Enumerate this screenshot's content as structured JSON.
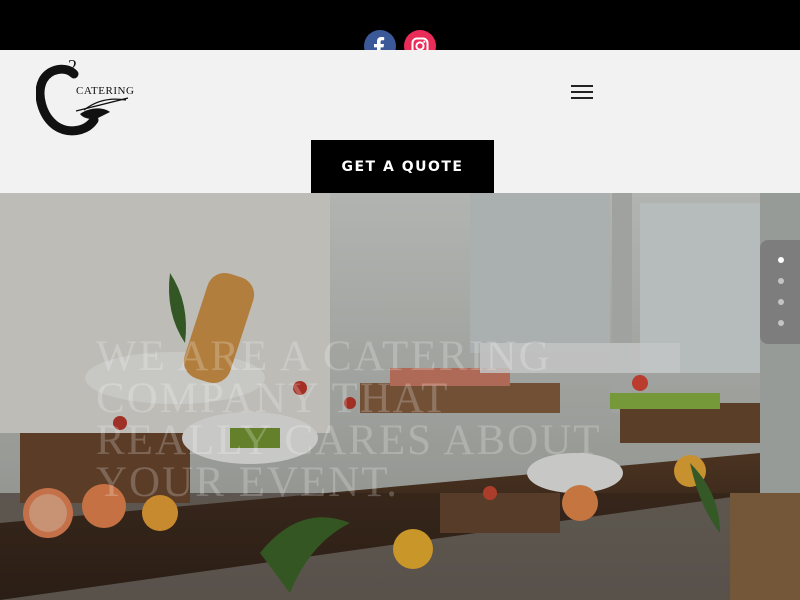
{
  "social": {
    "facebook_icon": "facebook-icon",
    "instagram_icon": "instagram-icon",
    "colors": {
      "facebook": "#3b5998",
      "instagram": "#ea2c59"
    }
  },
  "logo": {
    "superscript": "2",
    "wordmark": "CATERING"
  },
  "header": {
    "menu_icon": "hamburger-menu-icon",
    "cta_label": "GET A QUOTE"
  },
  "hero": {
    "headline": "WE ARE A CATERING COMPANY THAT REALLY CARES ABOUT YOUR EVENT.",
    "slides": [
      {
        "active": true
      },
      {
        "active": false
      },
      {
        "active": false
      },
      {
        "active": false
      }
    ]
  },
  "colors": {
    "top_bar": "#000000",
    "header_bg": "#f2f2f2",
    "button_bg": "#000000",
    "button_text": "#ffffff"
  }
}
